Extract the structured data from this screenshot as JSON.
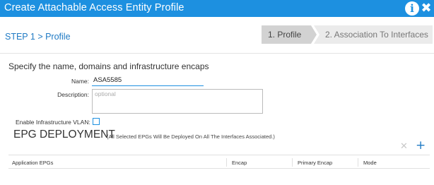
{
  "window": {
    "title": "Create Attachable Access Entity Profile",
    "info_icon": "info-icon",
    "close_icon": "close-icon",
    "titlebar_color": "#1d90e0"
  },
  "step": {
    "label": "STEP 1 > Profile",
    "wizard": [
      {
        "label": "1. Profile",
        "active": true
      },
      {
        "label": "2. Association To Interfaces",
        "active": false
      }
    ]
  },
  "form": {
    "intro": "Specify the name, domains and infrastructure encaps",
    "name_label": "Name:",
    "name_value": "ASA5585",
    "description_label": "Description:",
    "description_placeholder": "optional",
    "infra_vlan_label": "Enable Infrastructure VLAN:",
    "infra_vlan_checked": false
  },
  "epg": {
    "heading": "EPG DEPLOYMENT",
    "note": "(All Selected EPGs Will Be Deployed On All The Interfaces Associated.)",
    "delete_icon": "close-icon",
    "add_icon": "plus-icon",
    "columns": [
      "Application EPGs",
      "Encap",
      "Primary Encap",
      "Mode"
    ]
  }
}
